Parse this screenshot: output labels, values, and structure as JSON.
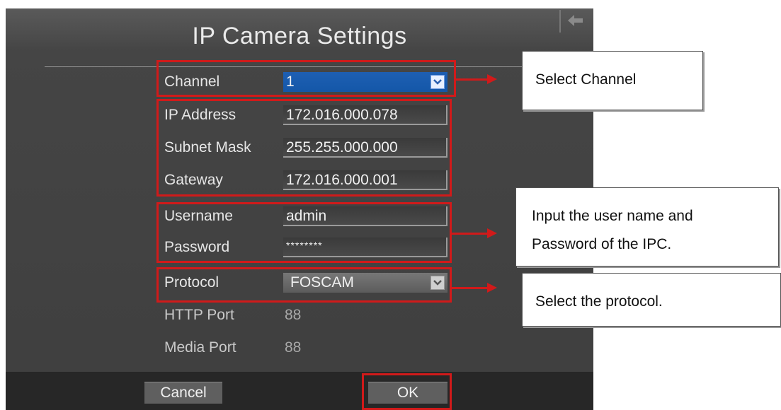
{
  "dialog": {
    "title": "IP Camera Settings"
  },
  "fields": {
    "channel": {
      "label": "Channel",
      "value": "1"
    },
    "ip_address": {
      "label": "IP Address",
      "value": "172.016.000.078"
    },
    "subnet_mask": {
      "label": "Subnet Mask",
      "value": "255.255.000.000"
    },
    "gateway": {
      "label": "Gateway",
      "value": "172.016.000.001"
    },
    "username": {
      "label": "Username",
      "value": "admin"
    },
    "password": {
      "label": "Password",
      "value": "********"
    },
    "protocol": {
      "label": "Protocol",
      "value": "FOSCAM"
    },
    "http_port": {
      "label": "HTTP Port",
      "value": "88"
    },
    "media_port": {
      "label": "Media Port",
      "value": "88"
    }
  },
  "buttons": {
    "cancel": "Cancel",
    "ok": "OK"
  },
  "callouts": {
    "channel": "Select Channel",
    "credentials_line1": "Input the user name and",
    "credentials_line2": "Password of the IPC.",
    "protocol": "Select the protocol."
  },
  "colors": {
    "highlight": "#d11a1a",
    "selected_field": "#1e5fb3",
    "panel": "#454545"
  },
  "icons": {
    "back": "back-arrow-icon",
    "dropdown": "chevron-down-icon"
  }
}
